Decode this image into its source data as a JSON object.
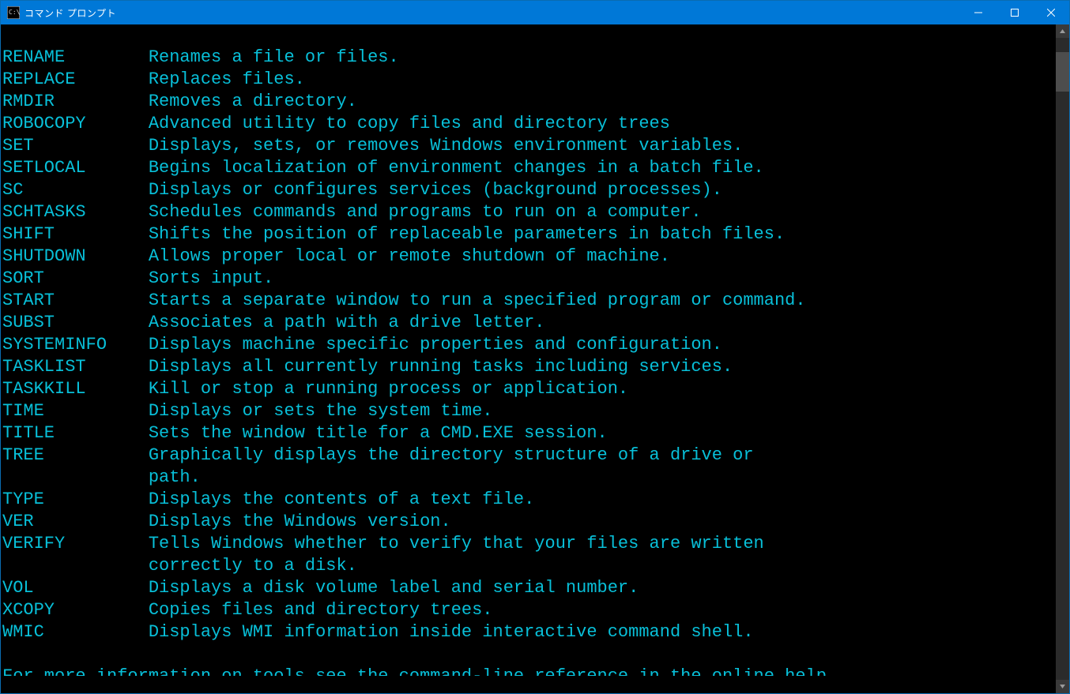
{
  "window": {
    "title": "コマンド プロンプト"
  },
  "terminal": {
    "description_column": 14,
    "commands": [
      {
        "name": "RENAME",
        "desc": [
          "Renames a file or files."
        ]
      },
      {
        "name": "REPLACE",
        "desc": [
          "Replaces files."
        ]
      },
      {
        "name": "RMDIR",
        "desc": [
          "Removes a directory."
        ]
      },
      {
        "name": "ROBOCOPY",
        "desc": [
          "Advanced utility to copy files and directory trees"
        ]
      },
      {
        "name": "SET",
        "desc": [
          "Displays, sets, or removes Windows environment variables."
        ]
      },
      {
        "name": "SETLOCAL",
        "desc": [
          "Begins localization of environment changes in a batch file."
        ]
      },
      {
        "name": "SC",
        "desc": [
          "Displays or configures services (background processes)."
        ]
      },
      {
        "name": "SCHTASKS",
        "desc": [
          "Schedules commands and programs to run on a computer."
        ]
      },
      {
        "name": "SHIFT",
        "desc": [
          "Shifts the position of replaceable parameters in batch files."
        ]
      },
      {
        "name": "SHUTDOWN",
        "desc": [
          "Allows proper local or remote shutdown of machine."
        ]
      },
      {
        "name": "SORT",
        "desc": [
          "Sorts input."
        ]
      },
      {
        "name": "START",
        "desc": [
          "Starts a separate window to run a specified program or command."
        ]
      },
      {
        "name": "SUBST",
        "desc": [
          "Associates a path with a drive letter."
        ]
      },
      {
        "name": "SYSTEMINFO",
        "desc": [
          "Displays machine specific properties and configuration."
        ]
      },
      {
        "name": "TASKLIST",
        "desc": [
          "Displays all currently running tasks including services."
        ]
      },
      {
        "name": "TASKKILL",
        "desc": [
          "Kill or stop a running process or application."
        ]
      },
      {
        "name": "TIME",
        "desc": [
          "Displays or sets the system time."
        ]
      },
      {
        "name": "TITLE",
        "desc": [
          "Sets the window title for a CMD.EXE session."
        ]
      },
      {
        "name": "TREE",
        "desc": [
          "Graphically displays the directory structure of a drive or",
          "path."
        ]
      },
      {
        "name": "TYPE",
        "desc": [
          "Displays the contents of a text file."
        ]
      },
      {
        "name": "VER",
        "desc": [
          "Displays the Windows version."
        ]
      },
      {
        "name": "VERIFY",
        "desc": [
          "Tells Windows whether to verify that your files are written",
          "correctly to a disk."
        ]
      },
      {
        "name": "VOL",
        "desc": [
          "Displays a disk volume label and serial number."
        ]
      },
      {
        "name": "XCOPY",
        "desc": [
          "Copies files and directory trees."
        ]
      },
      {
        "name": "WMIC",
        "desc": [
          "Displays WMI information inside interactive command shell."
        ]
      }
    ],
    "footer_blank_before": true,
    "footer": "For more information on tools see the command-line reference in the online help."
  }
}
